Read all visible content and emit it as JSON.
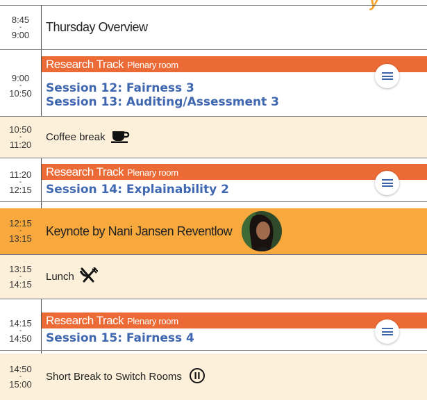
{
  "schedule": [
    {
      "type": "overview",
      "start": "8:45",
      "end": "9:00",
      "title": "Thursday Overview"
    },
    {
      "type": "track",
      "start": "9:00",
      "end": "10:50",
      "track": "Research Track",
      "room": "Plenary room",
      "sessions": [
        "Session 12: Fairness 3",
        "Session 13: Auditing/Assessment 3"
      ]
    },
    {
      "type": "break",
      "start": "10:50",
      "end": "11:20",
      "title": "Coffee break",
      "icon": "coffee-cup-icon"
    },
    {
      "type": "track",
      "start": "11:20",
      "end": "12:15",
      "track": "Research Track",
      "room": "Plenary room",
      "sessions": [
        "Session 14: Explainability 2"
      ]
    },
    {
      "type": "keynote",
      "start": "12:15",
      "end": "13:15",
      "title": "Keynote by Nani Jansen Reventlow",
      "icon": "speaker-avatar"
    },
    {
      "type": "break",
      "start": "13:15",
      "end": "14:15",
      "title": "Lunch",
      "icon": "fork-knife-icon"
    },
    {
      "type": "track",
      "start": "14:15",
      "end": "14:50",
      "track": "Research Track",
      "room": "Plenary room",
      "sessions": [
        "Session 15: Fairness 4"
      ]
    },
    {
      "type": "break",
      "start": "14:50",
      "end": "15:00",
      "title": "Short Break to Switch Rooms",
      "icon": "pause-icon"
    }
  ],
  "time_separator": "-",
  "colors": {
    "track_bar": "#ec6a35",
    "session_text": "#3f67b0",
    "beige": "#fdf0da",
    "keynote": "#f7a93e"
  }
}
